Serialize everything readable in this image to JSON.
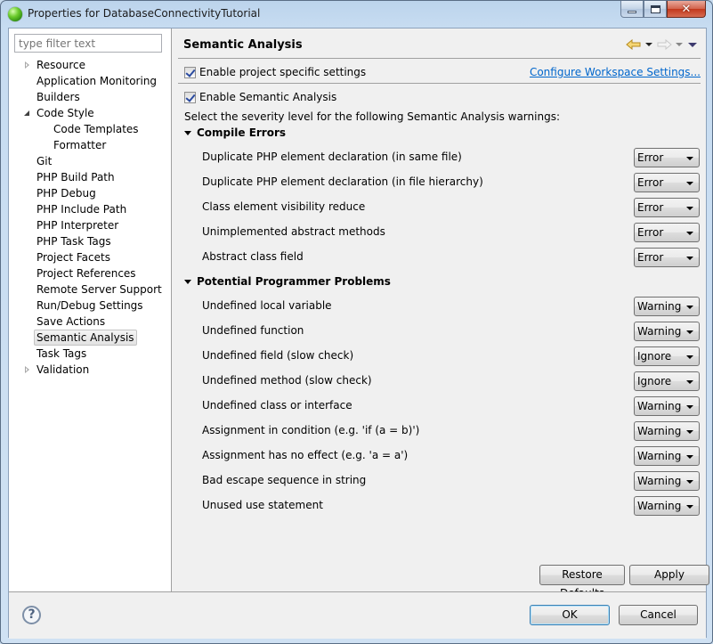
{
  "window": {
    "title": "Properties for DatabaseConnectivityTutorial",
    "controls": {
      "minimize": "minimize",
      "maximize": "maximize",
      "close": "close"
    }
  },
  "sidebar": {
    "filter_placeholder": "type filter text",
    "filter_value": "",
    "items": [
      {
        "label": "Resource",
        "twisty": "collapsed",
        "level": 0
      },
      {
        "label": "Application Monitoring",
        "twisty": "",
        "level": 0
      },
      {
        "label": "Builders",
        "twisty": "",
        "level": 0
      },
      {
        "label": "Code Style",
        "twisty": "expanded",
        "level": 0
      },
      {
        "label": "Code Templates",
        "twisty": "",
        "level": 1
      },
      {
        "label": "Formatter",
        "twisty": "",
        "level": 1
      },
      {
        "label": "Git",
        "twisty": "",
        "level": 0
      },
      {
        "label": "PHP Build Path",
        "twisty": "",
        "level": 0
      },
      {
        "label": "PHP Debug",
        "twisty": "",
        "level": 0
      },
      {
        "label": "PHP Include Path",
        "twisty": "",
        "level": 0
      },
      {
        "label": "PHP Interpreter",
        "twisty": "",
        "level": 0
      },
      {
        "label": "PHP Task Tags",
        "twisty": "",
        "level": 0
      },
      {
        "label": "Project Facets",
        "twisty": "",
        "level": 0
      },
      {
        "label": "Project References",
        "twisty": "",
        "level": 0
      },
      {
        "label": "Remote Server Support",
        "twisty": "",
        "level": 0
      },
      {
        "label": "Run/Debug Settings",
        "twisty": "",
        "level": 0
      },
      {
        "label": "Save Actions",
        "twisty": "",
        "level": 0
      },
      {
        "label": "Semantic Analysis",
        "twisty": "",
        "level": 0,
        "selected": true
      },
      {
        "label": "Task Tags",
        "twisty": "",
        "level": 0
      },
      {
        "label": "Validation",
        "twisty": "collapsed",
        "level": 0
      }
    ]
  },
  "page": {
    "title": "Semantic Analysis",
    "nav": {
      "back": "back-arrow",
      "forward": "forward-arrow",
      "menu": "view-menu"
    },
    "enable_project_specific": {
      "label": "Enable project specific settings",
      "checked": true
    },
    "configure_link": "Configure Workspace Settings...",
    "enable_semantic": {
      "label": "Enable Semantic Analysis",
      "checked": true
    },
    "description": "Select the severity level for the following Semantic Analysis warnings:",
    "sections": [
      {
        "title": "Compile Errors",
        "options": [
          {
            "label": "Duplicate PHP element declaration (in same file)",
            "value": "Error"
          },
          {
            "label": "Duplicate PHP element declaration (in file hierarchy)",
            "value": "Error"
          },
          {
            "label": "Class element visibility reduce",
            "value": "Error"
          },
          {
            "label": "Unimplemented abstract methods",
            "value": "Error"
          },
          {
            "label": "Abstract class field",
            "value": "Error"
          }
        ]
      },
      {
        "title": "Potential Programmer Problems",
        "options": [
          {
            "label": "Undefined local variable",
            "value": "Warning"
          },
          {
            "label": "Undefined function",
            "value": "Warning"
          },
          {
            "label": "Undefined field (slow check)",
            "value": "Ignore"
          },
          {
            "label": "Undefined method (slow check)",
            "value": "Ignore"
          },
          {
            "label": "Undefined class or interface",
            "value": "Warning"
          },
          {
            "label": "Assignment in condition (e.g. 'if (a = b)')",
            "value": "Warning"
          },
          {
            "label": "Assignment has no effect (e.g. 'a = a')",
            "value": "Warning"
          },
          {
            "label": "Bad escape sequence in string",
            "value": "Warning"
          },
          {
            "label": "Unused use statement",
            "value": "Warning"
          }
        ]
      }
    ],
    "restore_defaults": "Restore Defaults",
    "apply": "Apply"
  },
  "footer": {
    "help": "?",
    "ok": "OK",
    "cancel": "Cancel"
  }
}
